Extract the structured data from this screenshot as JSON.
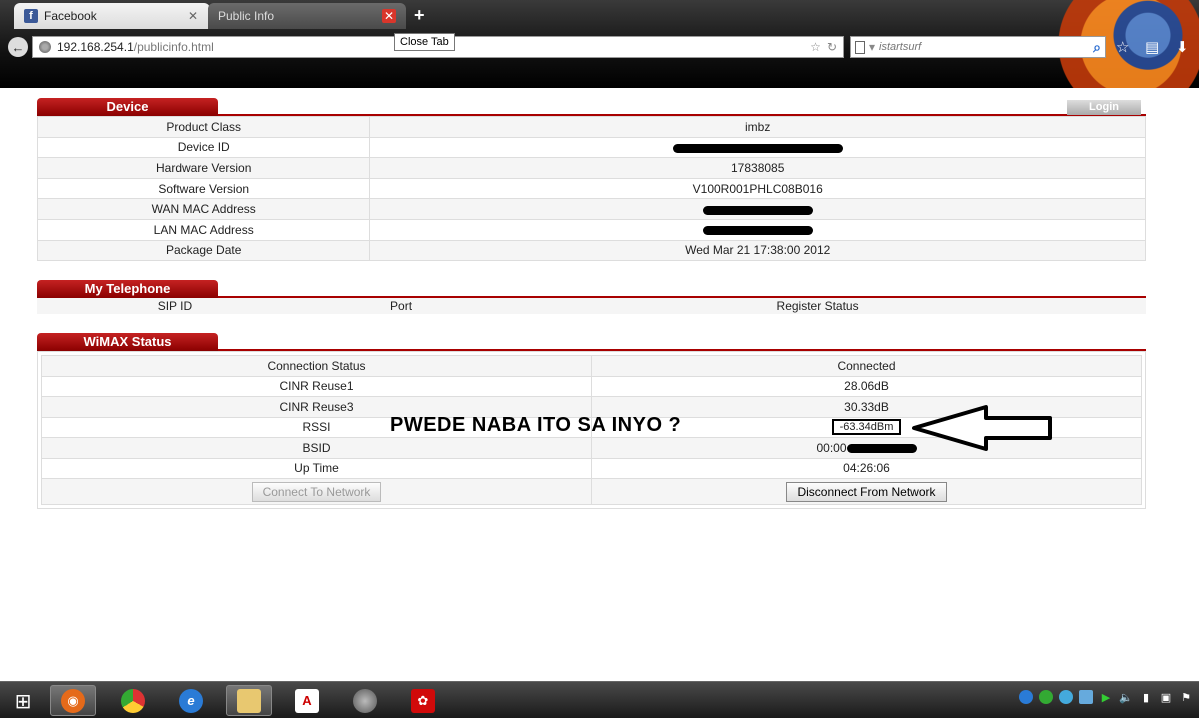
{
  "browser": {
    "tabs": [
      {
        "title": "Facebook",
        "active": false
      },
      {
        "title": "Public Info",
        "active": true
      }
    ],
    "tooltip": "Close Tab",
    "url": {
      "host": "192.168.254.1",
      "path": "/publicinfo.html"
    },
    "search_placeholder": "istartsurf"
  },
  "device": {
    "title": "Device",
    "login_label": "Login",
    "rows": [
      {
        "label": "Product Class",
        "value": "imbz"
      },
      {
        "label": "Device ID",
        "value": ""
      },
      {
        "label": "Hardware Version",
        "value": "17838085"
      },
      {
        "label": "Software Version",
        "value": "V100R001PHLC08B016"
      },
      {
        "label": "WAN MAC Address",
        "value": ""
      },
      {
        "label": "LAN MAC Address",
        "value": ""
      },
      {
        "label": "Package Date",
        "value": "Wed Mar 21 17:38:00 2012"
      }
    ]
  },
  "telephone": {
    "title": "My Telephone",
    "columns": [
      "SIP ID",
      "Port",
      "Register Status"
    ]
  },
  "wimax": {
    "title": "WiMAX Status",
    "rows": [
      {
        "label": "Connection Status",
        "value": "Connected"
      },
      {
        "label": "CINR Reuse1",
        "value": "28.06dB"
      },
      {
        "label": "CINR Reuse3",
        "value": "30.33dB"
      },
      {
        "label": "RSSI",
        "value": "-63.34dBm"
      },
      {
        "label": "BSID",
        "value": "00:00"
      },
      {
        "label": "Up Time",
        "value": "04:26:06"
      }
    ],
    "connect_label": "Connect To Network",
    "disconnect_label": "Disconnect From Network"
  },
  "annotation": "PWEDE NABA ITO SA INYO ?",
  "colors": {
    "accent": "#a80000",
    "tab_red": "#c52222"
  }
}
